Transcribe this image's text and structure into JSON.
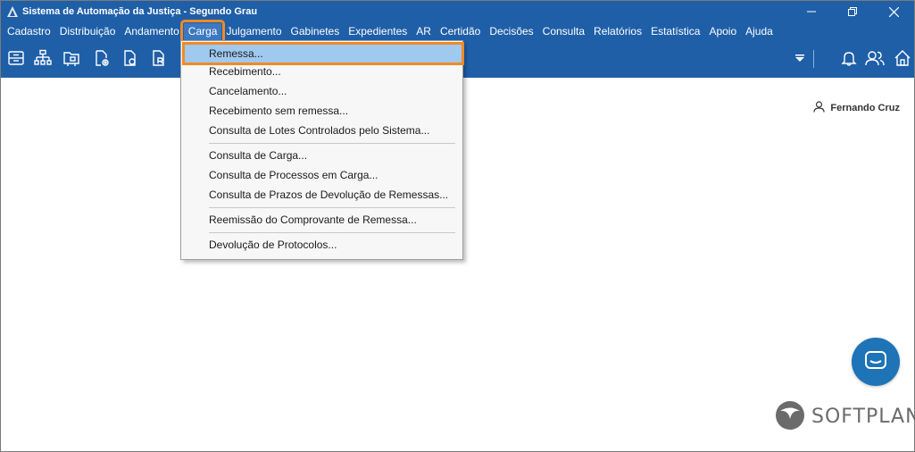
{
  "window": {
    "title": "Sistema de Automação da Justiça - Segundo Grau",
    "controls": [
      "minimize",
      "maximize",
      "close"
    ]
  },
  "menubar": {
    "items": [
      {
        "label": "Cadastro"
      },
      {
        "label": "Distribuição"
      },
      {
        "label": "Andamento"
      },
      {
        "label": "Carga",
        "active": true
      },
      {
        "label": "Julgamento"
      },
      {
        "label": "Gabinetes"
      },
      {
        "label": "Expedientes"
      },
      {
        "label": "AR"
      },
      {
        "label": "Certidão"
      },
      {
        "label": "Decisões"
      },
      {
        "label": "Consulta"
      },
      {
        "label": "Relatórios"
      },
      {
        "label": "Estatística"
      },
      {
        "label": "Apoio"
      },
      {
        "label": "Ajuda"
      }
    ]
  },
  "toolbar": {
    "icons": [
      "archive-icon",
      "org-chart-icon",
      "folder-icon",
      "settings-doc-icon",
      "document-clock-icon",
      "document-r-icon"
    ],
    "right_icons": [
      "dropdown-arrow-icon",
      "bell-icon",
      "users-icon",
      "home-icon"
    ]
  },
  "user": {
    "name": "Fernando Cruz"
  },
  "carga_menu": {
    "items": [
      {
        "label": "Remessa...",
        "highlight": true
      },
      {
        "label": "Recebimento..."
      },
      {
        "label": "Cancelamento..."
      },
      {
        "label": "Recebimento sem remessa..."
      },
      {
        "label": "Consulta de Lotes Controlados pelo Sistema..."
      },
      {
        "label": "Consulta de Carga..."
      },
      {
        "label": "Consulta de Processos em Carga..."
      },
      {
        "label": "Consulta de Prazos de Devolução de Remessas..."
      },
      {
        "label": "Reemissão do Comprovante de Remessa..."
      },
      {
        "label": "Devolução de Protocolos..."
      }
    ]
  },
  "logo": {
    "text": "SOFTPLAN"
  },
  "colors": {
    "brand_blue": "#1f5fa8",
    "highlight_orange": "#f08a24",
    "menu_highlight": "#9fc9ef",
    "chat_blue": "#1f73b7"
  }
}
